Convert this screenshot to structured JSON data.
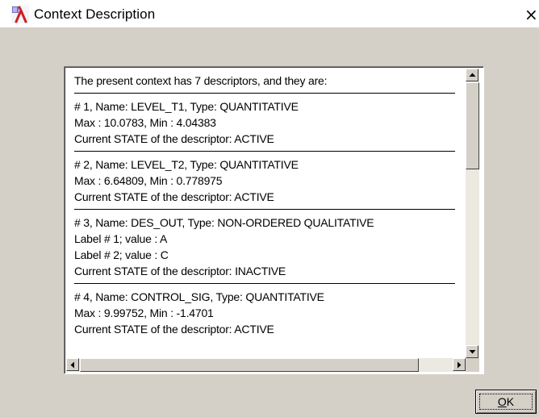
{
  "window": {
    "title": "Context Description",
    "close_glyph": "×",
    "icon": "lambda-app-icon"
  },
  "content": {
    "intro": "The present context has 7 descriptors, and they are:",
    "descriptors": [
      {
        "lines": [
          "# 1,  Name: LEVEL_T1,  Type: QUANTITATIVE",
          "Max : 10.0783,  Min : 4.04383",
          "Current STATE of the descriptor: ACTIVE"
        ]
      },
      {
        "lines": [
          "# 2,  Name: LEVEL_T2,  Type: QUANTITATIVE",
          "Max : 6.64809,  Min : 0.778975",
          "Current STATE of the descriptor: ACTIVE"
        ]
      },
      {
        "lines": [
          "# 3,  Name: DES_OUT,  Type: NON-ORDERED QUALITATIVE",
          "Label # 1; value : A",
          "Label # 2; value : C",
          "Current STATE of the descriptor: INACTIVE"
        ]
      },
      {
        "lines": [
          "# 4,  Name: CONTROL_SIG,  Type: QUANTITATIVE",
          "Max : 9.99752,  Min : -1.4701",
          "Current STATE of the descriptor: ACTIVE"
        ]
      }
    ]
  },
  "buttons": {
    "ok_mnemonic": "O",
    "ok_rest": "K"
  },
  "colors": {
    "dialog_bg": "#d4d0c8",
    "titlebar_bg": "#ffffff",
    "icon_red": "#cc2222"
  }
}
